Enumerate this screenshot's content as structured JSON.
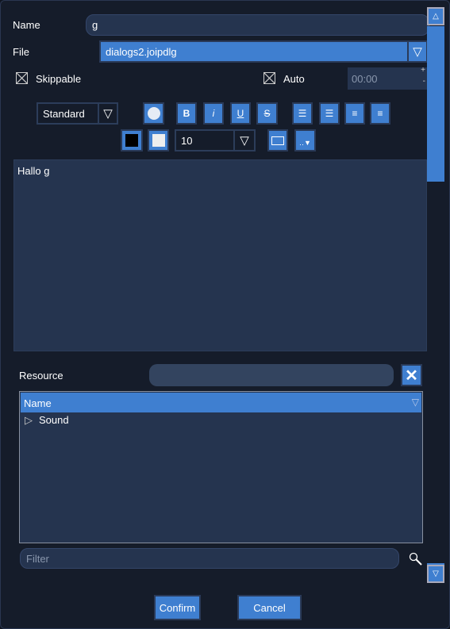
{
  "form": {
    "name_label": "Name",
    "name_value": "g",
    "file_label": "File",
    "file_value": "dialogs2.joipdlg",
    "skippable_label": "Skippable",
    "auto_label": "Auto",
    "time_value": "00:00"
  },
  "toolbar": {
    "style_value": "Standard",
    "bold": "B",
    "italic": "i",
    "underline": "U",
    "strike": "S",
    "font_size": "10"
  },
  "editor": {
    "text": "Hallo g"
  },
  "resource": {
    "label": "Resource",
    "value": "",
    "tree_header": "Name",
    "items": [
      {
        "label": "Sound"
      }
    ],
    "filter_placeholder": "Filter"
  },
  "footer": {
    "confirm": "Confirm",
    "cancel": "Cancel"
  },
  "colors": {
    "accent": "#3f7fd0",
    "background": "#151c2a",
    "panel": "#25344f"
  }
}
